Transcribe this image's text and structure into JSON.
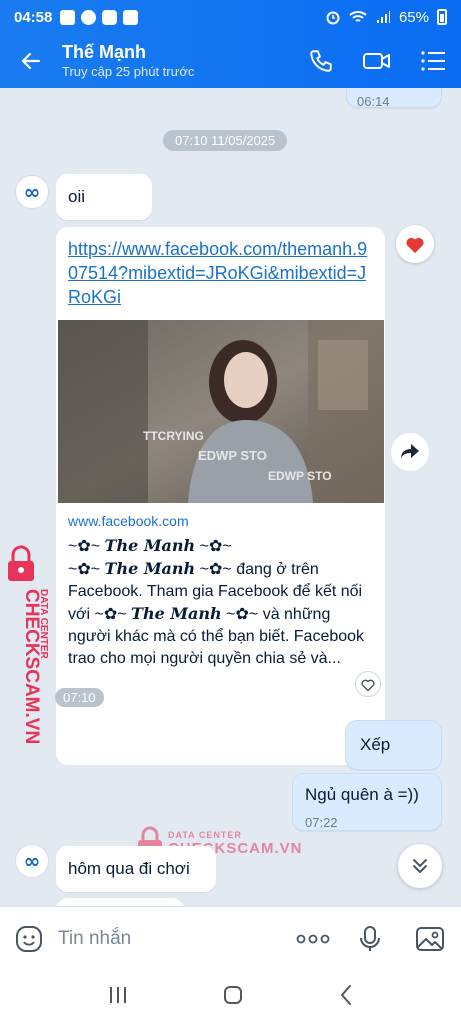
{
  "status_bar": {
    "time": "04:58",
    "battery": "65%"
  },
  "header": {
    "name": "Thế Mạnh",
    "status": "Truy cập 25 phút trước"
  },
  "chat": {
    "prev_time": "06:14",
    "date_separator": "07:10 11/05/2025",
    "msg1": "oii",
    "link_card": {
      "url": "https://www.facebook.com/themanh.907514?mibextid=JRoKGi&mibextid=JRoKGi",
      "domain": "www.facebook.com",
      "name_line1": "The Manh",
      "name_line2": "The Manh",
      "text1": "đang ở trên Facebook. Tham gia Facebook để kết nối với",
      "name_line3": "The Manh",
      "text2": "và những người khác mà có thể bạn biết. Facebook trao cho mọi người quyền chia sẻ và...",
      "time": "07:10"
    },
    "reply1": "Xếp",
    "reply2": "Ngủ quên à =))",
    "reply_time": "07:22",
    "msg3": "hôm qua đi chơi"
  },
  "watermark": {
    "label": "DATA CENTER",
    "brand": "CHECKSCAM.VN",
    "color": "#e8345a"
  },
  "composer": {
    "placeholder": "Tin nhắn"
  },
  "colors": {
    "accent": "#0a6cf2",
    "heart": "#e53935"
  }
}
